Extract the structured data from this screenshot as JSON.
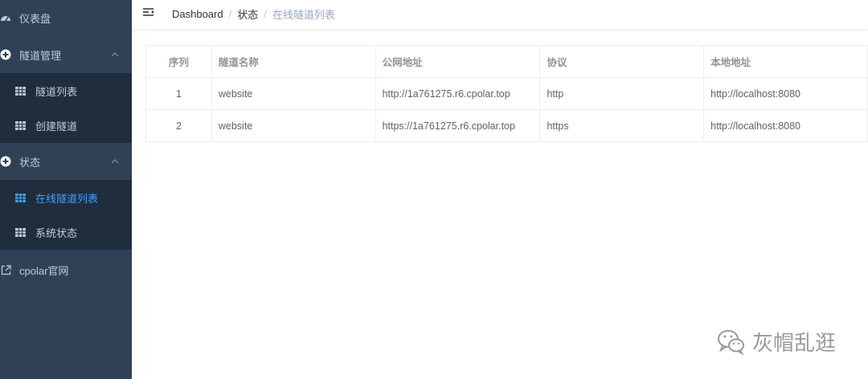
{
  "sidebar": {
    "dashboard": {
      "label": "仪表盘",
      "icon": "dashboard-gauge-icon"
    },
    "tunnel_mgmt": {
      "label": "隧道管理",
      "icon": "plus-circle-icon",
      "expanded": true,
      "items": [
        {
          "label": "隧道列表",
          "icon": "grid-table-icon"
        },
        {
          "label": "创建隧道",
          "icon": "grid-table-icon"
        }
      ]
    },
    "status": {
      "label": "状态",
      "icon": "plus-circle-icon",
      "expanded": true,
      "items": [
        {
          "label": "在线隧道列表",
          "icon": "grid-table-icon",
          "active": true
        },
        {
          "label": "系统状态",
          "icon": "grid-table-icon"
        }
      ]
    },
    "website": {
      "label": "cpolar官网",
      "icon": "external-link-icon"
    }
  },
  "header": {
    "breadcrumb": [
      "Dashboard",
      "状态",
      "在线隧道列表"
    ],
    "separator": "/"
  },
  "table": {
    "columns": [
      "序列",
      "隧道名称",
      "公网地址",
      "协议",
      "本地地址"
    ],
    "rows": [
      [
        "1",
        "website",
        "http://1a761275.r6.cpolar.top",
        "http",
        "http://localhost:8080"
      ],
      [
        "2",
        "website",
        "https://1a761275.r6.cpolar.top",
        "https",
        "http://localhost:8080"
      ]
    ]
  },
  "watermark": {
    "text": "灰帽乱逛",
    "icon": "wechat-icon"
  },
  "colors": {
    "sidebar_bg": "#304156",
    "submenu_bg": "#1f2d3d",
    "sidebar_text": "#bfcbd9",
    "active": "#409eff",
    "border": "#ebeef5"
  }
}
